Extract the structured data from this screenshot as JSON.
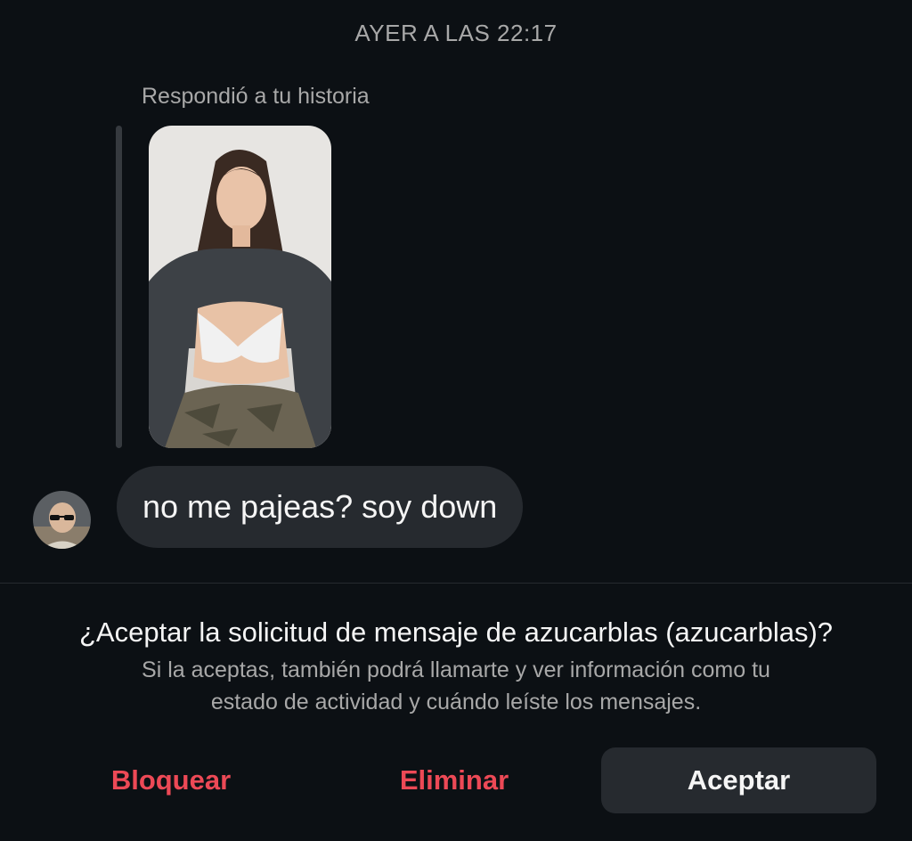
{
  "chat": {
    "timestamp": "AYER A LAS 22:17",
    "story_caption": "Respondió a tu historia",
    "message": "no me pajeas? soy down"
  },
  "request": {
    "title": "¿Aceptar la solicitud de mensaje de azucarblas (azucarblas)?",
    "body_line1": "Si la aceptas, también podrá llamarte y ver información como tu",
    "body_line2": "estado de actividad y cuándo leíste los mensajes."
  },
  "actions": {
    "block_label": "Bloquear",
    "delete_label": "Eliminar",
    "accept_label": "Aceptar"
  },
  "colors": {
    "background": "#0c1014",
    "bubble": "#262a2f",
    "danger": "#ed4956",
    "secondary_text": "#a8a8a8"
  }
}
